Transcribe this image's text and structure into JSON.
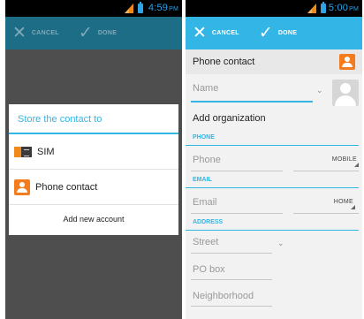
{
  "left": {
    "status_time": "4:59",
    "status_ampm": "PM",
    "cancel_label": "CANCEL",
    "done_label": "DONE",
    "dialog": {
      "title": "Store the contact to",
      "options": [
        "SIM",
        "Phone contact"
      ],
      "footer": "Add new account"
    }
  },
  "right": {
    "status_time": "5:00",
    "status_ampm": "PM",
    "cancel_label": "CANCEL",
    "done_label": "DONE",
    "account_title": "Phone contact",
    "name_placeholder": "Name",
    "org_label": "Add organization",
    "sections": {
      "phone": "PHONE",
      "email": "EMAIL",
      "address": "ADDRESS"
    },
    "phone_placeholder": "Phone",
    "phone_type": "MOBILE",
    "email_placeholder": "Email",
    "email_type": "HOME",
    "street_placeholder": "Street",
    "pobox_placeholder": "PO box",
    "neighborhood_placeholder": "Neighborhood"
  },
  "colors": {
    "accent": "#33b5e5",
    "accent_dim": "#1d6d87",
    "contact_orange": "#f47c1d",
    "scrim": "#4e4e4e"
  },
  "icons": [
    "signal-icon",
    "battery-icon",
    "cancel-x-icon",
    "done-check-icon",
    "sim-card-icon",
    "contact-icon",
    "avatar-placeholder-icon",
    "chevron-down-icon"
  ]
}
